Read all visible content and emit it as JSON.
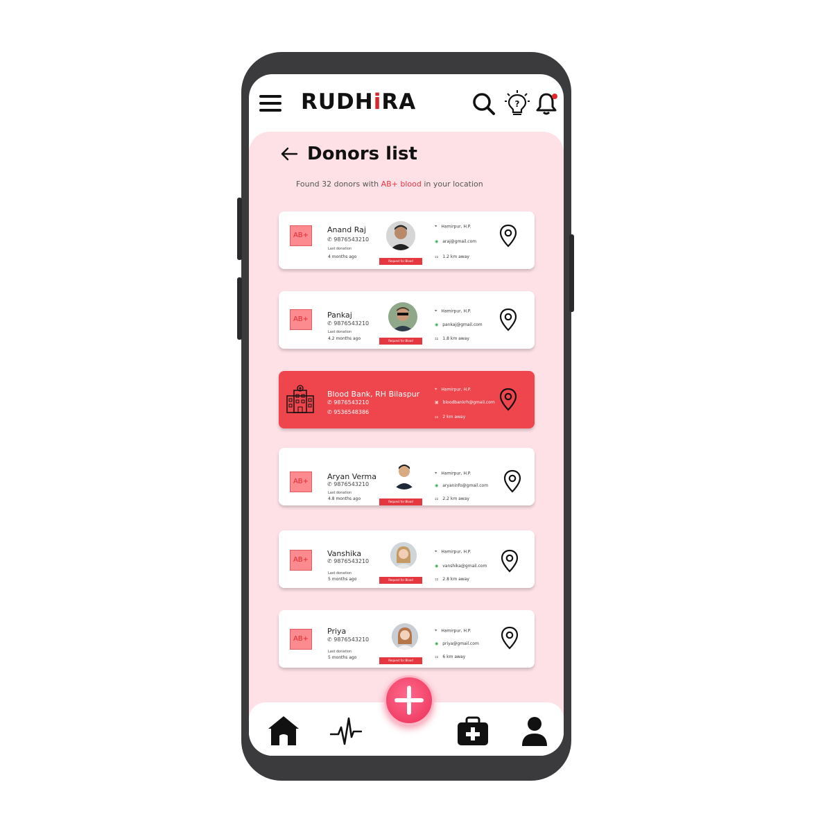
{
  "app": {
    "brand_prefix": "RUDH",
    "brand_i": "i",
    "brand_suffix": "RA"
  },
  "page": {
    "title": "Donors list",
    "subtitle_before": "Found 32 donors with ",
    "subtitle_highlight": "AB+ blood",
    "subtitle_after": " in your location"
  },
  "colors": {
    "accent": "#e53740",
    "card_bank": "#ef454c",
    "bg_pink": "#fde1e7",
    "fab": "#ec2f58"
  },
  "cards": [
    {
      "type": "donor",
      "badge": "AB+",
      "name": "Anand Raj",
      "phone": "9876543210",
      "last_label": "Last donation",
      "last_value": "4 months ago",
      "request": "Request for Blood",
      "location": "Hamirpur, H.P.",
      "email": "araj@gmail.com",
      "distance": "1.2 km away"
    },
    {
      "type": "donor",
      "badge": "AB+",
      "name": "Pankaj",
      "phone": "9876543210",
      "last_label": "Last donation",
      "last_value": "4.2 months ago",
      "request": "Request for Blood",
      "location": "Hamirpur, H.P.",
      "email": "pankaj@gmail.com",
      "distance": "1.8 km away"
    },
    {
      "type": "bank",
      "name": "Blood Bank, RH Bilaspur",
      "phone": "9876543210",
      "phone2": "9536548386",
      "location": "Hamirpur, H.P.",
      "email": "bloodbankrh@gmail.com",
      "distance": "2 km away"
    },
    {
      "type": "donor",
      "badge": "AB+",
      "name": "Aryan Verma",
      "phone": "9876543210",
      "last_label": "Last donation",
      "last_value": "4.8 months ago",
      "request": "Request for Blood",
      "location": "Hamirpur, H.P.",
      "email": "aryaninfo@gmail.com",
      "distance": "2.2 km away"
    },
    {
      "type": "donor",
      "badge": "AB+",
      "name": "Vanshika",
      "phone": "9876543210",
      "last_label": "Last donation",
      "last_value": "5 months ago",
      "request": "Request for Blood",
      "location": "Hamirpur, H.P.",
      "email": "vanshika@gmail.com",
      "distance": "2.8 km away"
    },
    {
      "type": "donor",
      "badge": "AB+",
      "name": "Priya",
      "phone": "9876543210",
      "last_label": "Last donation",
      "last_value": "5 months ago",
      "request": "Request for Blood",
      "location": "Hamirpur, H.P.",
      "email": "priya@gmail.com",
      "distance": "6 km away"
    }
  ],
  "icons": {
    "header": [
      "menu-icon",
      "search-icon",
      "help-bulb-icon",
      "bell-icon"
    ],
    "nav": [
      "home-icon",
      "pulse-icon",
      "add-icon",
      "first-aid-icon",
      "user-icon"
    ]
  }
}
